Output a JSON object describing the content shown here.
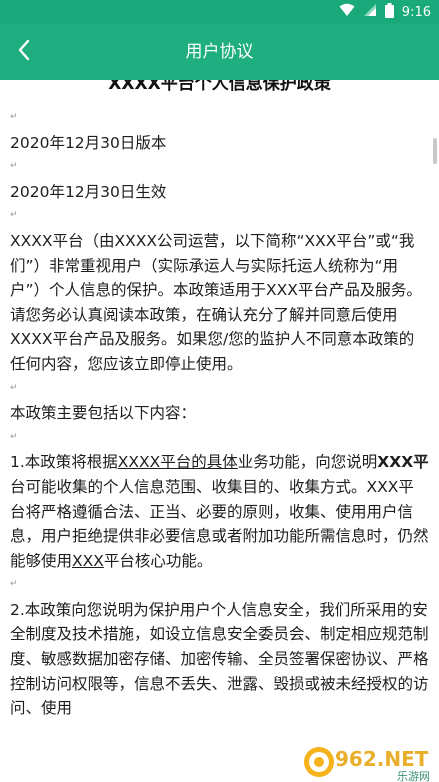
{
  "status_bar": {
    "time": "9:16"
  },
  "header": {
    "title": "用户协议"
  },
  "document": {
    "title": "XXXX平台个人信息保护政策",
    "version": "2020年12月30日版本",
    "effective": "2020年12月30日生效",
    "intro": "XXXX平台（由XXXX公司运营，以下简称“XXX平台”或“我们”）非常重视用户（实际承运人与实际托运人统称为“用户”）个人信息的保护。本政策适用于XXX平台产品及服务。请您务必认真阅读本政策，在确认充分了解并同意后使用XXXX平台产品及服务。如果您/您的监护人不同意本政策的任何内容，您应该立即停止使用。",
    "list_intro": "本政策主要包括以下内容：",
    "item1": {
      "prefix": "1.本政策将根据",
      "underlined": "XXXX平台的具体",
      "middle": "业务功能，向您说明",
      "bold": "XXX平",
      "rest": "台可能收集的个人信息范围、收集目的、收集方式。XXX平台将严格遵循合法、正当、必要的原则，收集、使用用户信息，用户拒绝提供非必要信息或者附加功能所需信息时，仍然能够使用",
      "underlined2": "XXX",
      "end": "平台核心功能。"
    },
    "item2": "2.本政策向您说明为保护用户个人信息安全，我们所采用的安全制度及技术措施，如设立信息安全委员会、制定相应规范制度、敏感数据加密存储、加密传输、全员签署保密协议、严格控制访问权限等，",
    "item2_cut": "信息不丢失、泄露、毁损或被未经授权的访问、使用"
  },
  "watermark": {
    "text": "962.NET",
    "subtext": "乐游网"
  },
  "colors": {
    "accent": "#1fae80",
    "status": "#1aa97a"
  }
}
